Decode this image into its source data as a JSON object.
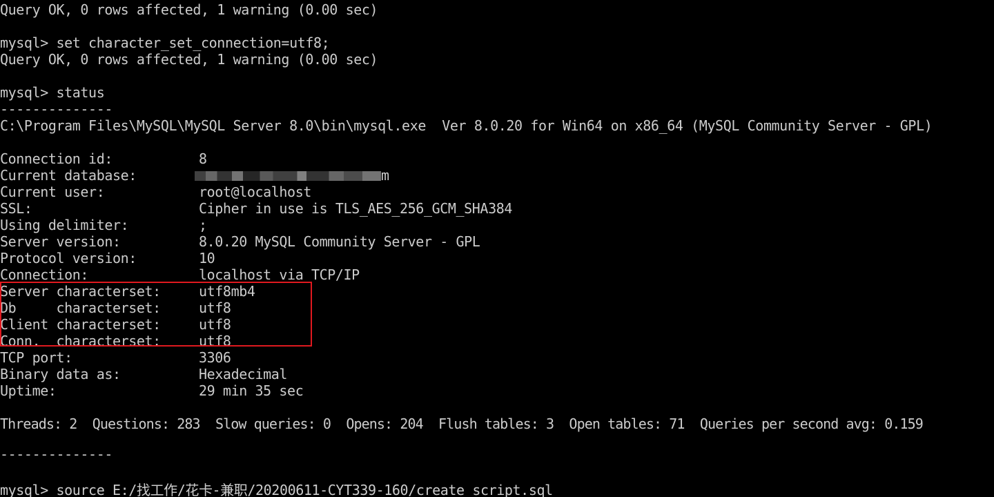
{
  "colors": {
    "background": "#000000",
    "text": "#cccccc",
    "highlight_border": "#e0191f"
  },
  "terminal": {
    "pre_lines": [
      "Query OK, 0 rows affected, 1 warning (0.00 sec)",
      "mysql> set character_set_connection=utf8;",
      "Query OK, 0 rows affected, 1 warning (0.00 sec)",
      "mysql> status",
      "--------------",
      "C:\\Program Files\\MySQL\\MySQL Server 8.0\\bin\\mysql.exe  Ver 8.0.20 for Win64 on x86_64 (MySQL Community Server - GPL)"
    ],
    "status": [
      {
        "key": "Connection id:",
        "value": "8"
      },
      {
        "key": "Current database:",
        "value": "m"
      },
      {
        "key": "Current user:",
        "value": "root@localhost"
      },
      {
        "key": "SSL:",
        "value": "Cipher in use is TLS_AES_256_GCM_SHA384"
      },
      {
        "key": "Using delimiter:",
        "value": ";"
      },
      {
        "key": "Server version:",
        "value": "8.0.20 MySQL Community Server - GPL"
      },
      {
        "key": "Protocol version:",
        "value": "10"
      },
      {
        "key": "Connection:",
        "value": "localhost via TCP/IP"
      },
      {
        "key": "Server characterset:",
        "value": "utf8mb4"
      },
      {
        "key": "Db     characterset:",
        "value": "utf8"
      },
      {
        "key": "Client characterset:",
        "value": "utf8"
      },
      {
        "key": "Conn.  characterset:",
        "value": "utf8"
      },
      {
        "key": "TCP port:",
        "value": "3306"
      },
      {
        "key": "Binary data as:",
        "value": "Hexadecimal"
      },
      {
        "key": "Uptime:",
        "value": "29 min 35 sec"
      }
    ],
    "threads_line": "Threads: 2  Questions: 283  Slow queries: 0  Opens: 204  Flush tables: 3  Open tables: 71  Queries per second avg: 0.159",
    "separator_end": "--------------",
    "last_command": "mysql> source E:/找工作/花卡-兼职/20200611-CYT339-160/create_script.sql"
  }
}
